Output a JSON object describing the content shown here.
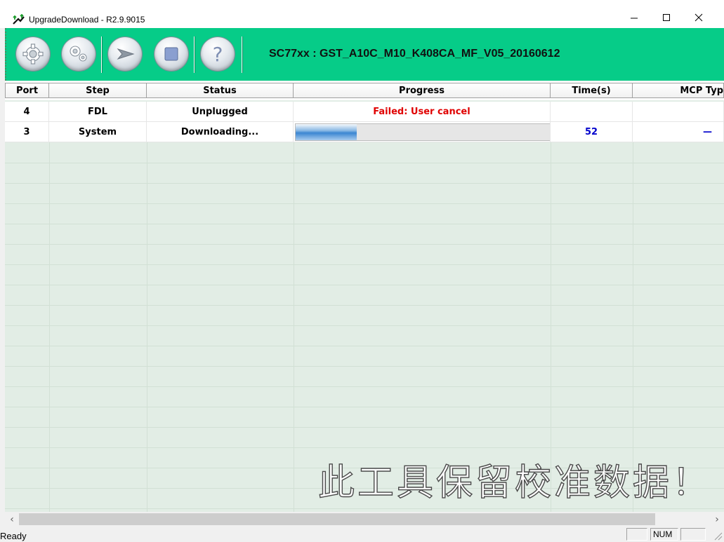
{
  "window": {
    "title": "UpgradeDownload - R2.9.9015",
    "icon": "green-arrows-app-icon",
    "controls": [
      "minimize-icon",
      "maximize-icon",
      "close-icon"
    ]
  },
  "toolbar": {
    "buttons": [
      {
        "name": "settings-button",
        "icon": "gear-icon"
      },
      {
        "name": "options-button",
        "icon": "gears-icon"
      },
      {
        "name": "start-button",
        "icon": "play-arrow-icon"
      },
      {
        "name": "stop-button",
        "icon": "stop-square-icon"
      },
      {
        "name": "help-button",
        "icon": "question-mark-icon"
      }
    ],
    "product_info": "SC77xx : GST_A10C_M10_K408CA_MF_V05_20160612",
    "background_color": "#06cc88"
  },
  "table": {
    "columns": [
      "Port",
      "Step",
      "Status",
      "Progress",
      "Time(s)",
      "MCP Typ"
    ],
    "rows": [
      {
        "port": "4",
        "step": "FDL",
        "status": "Unplugged",
        "progress_text": "Failed: User cancel",
        "time": "",
        "mcp": ""
      },
      {
        "port": "3",
        "step": "System",
        "status": "Downloading...",
        "progress_fraction": 0.24,
        "time": "52",
        "mcp": "—"
      }
    ],
    "error_color": "#e00000",
    "time_color": "#0000cc"
  },
  "watermark": "此工具保留校准数据！",
  "scrollbar": {
    "left_arrow": "‹",
    "right_arrow": "›"
  },
  "statusbar": {
    "status": "Ready",
    "panes": [
      "",
      "NUM",
      ""
    ]
  }
}
